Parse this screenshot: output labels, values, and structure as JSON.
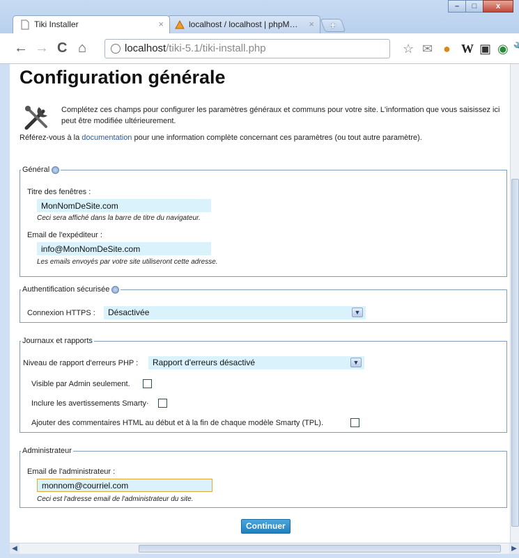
{
  "browser": {
    "tabs": [
      {
        "label": "Tiki Installer",
        "close": "×"
      },
      {
        "label": "localhost / localhost | phpM…",
        "close": "×"
      }
    ],
    "new_tab": "+",
    "window_buttons": {
      "minimize": "–",
      "maximize": "□",
      "close": "x"
    },
    "url_host": "localhost",
    "url_path": "/tiki-5.1/tiki-install.php",
    "nav": {
      "back": "←",
      "forward": "→",
      "reload": "C",
      "home": "⌂"
    }
  },
  "page": {
    "title": "Configuration générale",
    "intro": "Complétez ces champs pour configurer les paramètres généraux et communs pour votre site. L'information que vous saisissez ici peut être modifiée ultérieurement.",
    "doc_prefix": "Référez-vous à la ",
    "doc_link": "documentation",
    "doc_suffix": " pour une information complète concernant ces paramètres (ou tout autre paramètre).",
    "general": {
      "legend": "Général",
      "browser_title_label": "Titre des fenêtres :",
      "browser_title_value": "MonNomDeSite.com",
      "browser_title_note": "Ceci sera affiché dans la barre de titre du navigateur.",
      "sender_email_label": "Email de l'expéditeur :",
      "sender_email_value": "info@MonNomDeSite.com",
      "sender_email_note": "Les emails envoyés par votre site utiliseront cette adresse."
    },
    "auth": {
      "legend": "Authentification sécurisée",
      "https_label": "Connexion HTTPS :",
      "https_value": "Désactivée"
    },
    "logs": {
      "legend": "Journaux et rapports",
      "php_error_label": "Niveau de rapport d'erreurs PHP :",
      "php_error_value": "Rapport d'erreurs désactivé",
      "admin_only_label": "Visible par Admin seulement.",
      "smarty_warnings_label": "Inclure les avertissements Smarty·",
      "html_comments_label": "Ajouter des commentaires HTML au début et à la fin de chaque modèle Smarty (TPL)."
    },
    "admin": {
      "legend": "Administrateur",
      "admin_email_label": "Email de l'administrateur :",
      "admin_email_value": "monnom@courriel.com",
      "admin_email_note": "Ceci est l'adresse email de l'administrateur du site."
    },
    "submit_label": "Continuer"
  }
}
